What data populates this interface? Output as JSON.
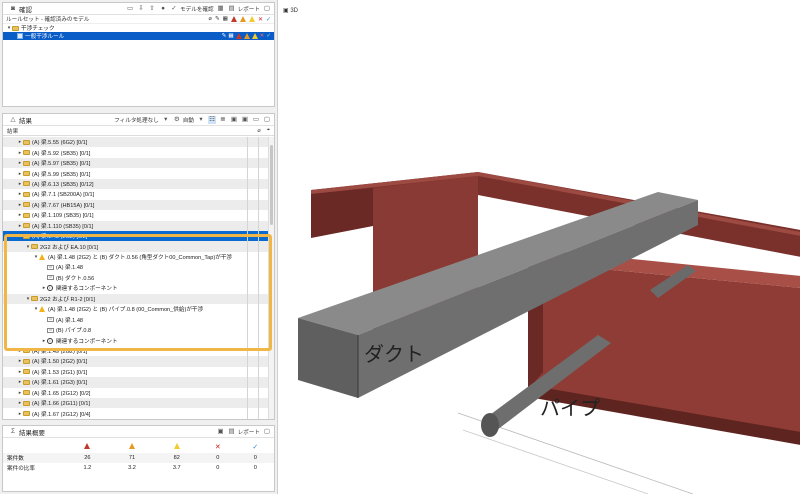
{
  "check_panel": {
    "title": "確認",
    "toolbar": {
      "check_model": "モデルを確認",
      "report": "レポート"
    },
    "ruleset_label": "ルールセット - 確認済みのモデル",
    "tree": [
      {
        "label": "干渉チェック",
        "level": 0
      },
      {
        "label": "一般干渉ルール",
        "level": 1,
        "selected": true
      }
    ]
  },
  "results_panel": {
    "title": "結果",
    "filter": "フィルタ処理なし",
    "auto": "自動",
    "column_header": "結果",
    "rows": [
      {
        "text": "(A) 梁.5.55 (6G2) [0/1]",
        "level": 0,
        "grey": true
      },
      {
        "text": "(A) 梁.5.92 (SB35) [0/1]",
        "level": 0,
        "grey": false
      },
      {
        "text": "(A) 梁.5.97 (SB35) [0/1]",
        "level": 0,
        "grey": true
      },
      {
        "text": "(A) 梁.5.99 (SB35) [0/1]",
        "level": 0,
        "grey": false
      },
      {
        "text": "(A) 梁.6.13 (SB35) [0/12]",
        "level": 0,
        "grey": true
      },
      {
        "text": "(A) 梁.7.1 (SB200A) [0/1]",
        "level": 0,
        "grey": false
      },
      {
        "text": "(A) 梁.7.67 (HB15A) [0/1]",
        "level": 0,
        "grey": true
      },
      {
        "text": "(A) 梁.1.109 (SB35) [0/1]",
        "level": 0,
        "grey": false
      },
      {
        "text": "(A) 梁.1.110 (SB35) [0/1]",
        "level": 0,
        "grey": true
      },
      {
        "text": "(A) 梁.1.48 (2G2) [0/2]",
        "level": 0,
        "selected": true
      },
      {
        "text": "2G2 および EA.10 [0/1]",
        "level": 1,
        "grey": true
      },
      {
        "text": "(A) 梁.1.48 (2G2) と (B) ダクト.0.56 (角型ダクト00_Common_Tap)が干渉",
        "level": 2
      },
      {
        "text": "(A) 梁.1.48",
        "level": 3,
        "kind": "part"
      },
      {
        "text": "(B) ダクト.0.56",
        "level": 3,
        "kind": "part"
      },
      {
        "text": "関連するコンポーネント",
        "level": 3,
        "kind": "info"
      },
      {
        "text": "2G2 および R1-2 [0/1]",
        "level": 1,
        "grey": true
      },
      {
        "text": "(A) 梁.1.48 (2G2) と (B) パイプ.0.8 (00_Common_供給)が干渉",
        "level": 2
      },
      {
        "text": "(A) 梁.1.48",
        "level": 3,
        "kind": "part"
      },
      {
        "text": "(B) パイプ.0.8",
        "level": 3,
        "kind": "part"
      },
      {
        "text": "関連するコンポーネント",
        "level": 3,
        "kind": "info"
      },
      {
        "text": "(A) 梁.1.49 (2G2) [0/1]",
        "level": 0,
        "grey": false
      },
      {
        "text": "(A) 梁.1.50 (2G2) [0/1]",
        "level": 0,
        "grey": true
      },
      {
        "text": "(A) 梁.1.53 (2G1) [0/1]",
        "level": 0,
        "grey": false
      },
      {
        "text": "(A) 梁.1.61 (2G3) [0/1]",
        "level": 0,
        "grey": true
      },
      {
        "text": "(A) 梁.1.65 (2G12) [0/2]",
        "level": 0,
        "grey": false
      },
      {
        "text": "(A) 梁.1.66 (2G11) [0/1]",
        "level": 0,
        "grey": true
      },
      {
        "text": "(A) 梁.1.67 (2G12) [0/4]",
        "level": 0,
        "grey": false
      }
    ]
  },
  "summary_panel": {
    "title": "結果概要",
    "report": "レポート",
    "rows": [
      {
        "label": "案件数",
        "values": [
          "26",
          "71",
          "82",
          "0",
          "0"
        ]
      },
      {
        "label": "案件の比率",
        "values": [
          "1.2",
          "3.2",
          "3.7",
          "0",
          "0"
        ]
      }
    ]
  },
  "view3d": {
    "tab_label": "3D",
    "label_duct": "ダクト",
    "label_pipe": "パイプ"
  },
  "colors": {
    "selection": "#0a6ad0",
    "highlight": "#f0b746",
    "beam": "#8a3a34",
    "duct": "#6b6b6b"
  }
}
